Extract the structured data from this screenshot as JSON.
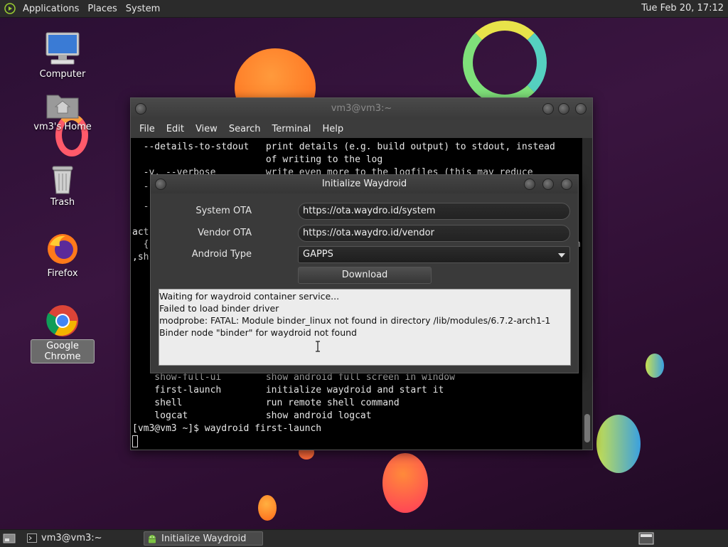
{
  "top_panel": {
    "menus": [
      "Applications",
      "Places",
      "System"
    ],
    "clock": "Tue Feb 20, 17:12"
  },
  "desktop_icons": [
    {
      "label": "Computer",
      "icon": "computer-icon"
    },
    {
      "label": "vm3's Home",
      "icon": "home-folder-icon"
    },
    {
      "label": "Trash",
      "icon": "trash-icon"
    },
    {
      "label": "Firefox",
      "icon": "firefox-icon"
    },
    {
      "label": "Google Chrome",
      "icon": "chrome-icon",
      "selected": true
    }
  ],
  "terminal": {
    "title": "vm3@vm3:~",
    "menu": [
      "File",
      "Edit",
      "View",
      "Search",
      "Terminal",
      "Help"
    ],
    "lines_top": [
      "  --details-to-stdout   print details (e.g. build output) to stdout, instead",
      "                        of writing to the log",
      "  -v, --verbose         write even more to the logfiles (this may reduce"
    ],
    "partial_left": [
      "  -",
      "  -",
      "act",
      "  {",
      ",sh"
    ],
    "partial_right": "n",
    "lines_bottom": [
      "    show-full-ui        show android full screen in window",
      "    first-launch        initialize waydroid and start it",
      "    shell               run remote shell command",
      "    logcat              show android logcat",
      "[vm3@vm3 ~]$ waydroid first-launch"
    ]
  },
  "dialog": {
    "title": "Initialize Waydroid",
    "system_ota_label": "System OTA",
    "system_ota_value": "https://ota.waydro.id/system",
    "vendor_ota_label": "Vendor OTA",
    "vendor_ota_value": "https://ota.waydro.id/vendor",
    "android_type_label": "Android Type",
    "android_type_value": "GAPPS",
    "download_label": "Download",
    "log": [
      "Waiting for waydroid container service...",
      "Failed to load binder driver",
      "modprobe: FATAL: Module binder_linux not found in directory /lib/modules/6.7.2-arch1-1",
      "Binder node \"binder\" for waydroid not found"
    ]
  },
  "taskbar": {
    "tasks": [
      {
        "label": "vm3@vm3:~",
        "icon": "terminal-icon",
        "active": false
      },
      {
        "label": "Initialize Waydroid",
        "icon": "android-icon",
        "active": true
      }
    ]
  }
}
